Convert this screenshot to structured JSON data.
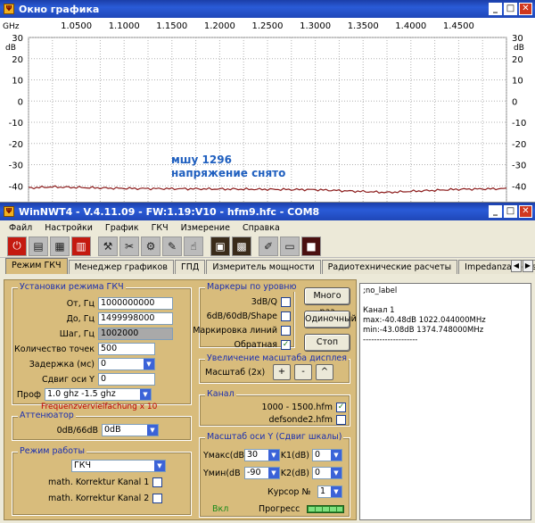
{
  "graph_window": {
    "title": "Окно графика",
    "unit_x": "GHz",
    "x_ticks": [
      "1.0500",
      "1.1000",
      "1.1500",
      "1.2000",
      "1.2500",
      "1.3000",
      "1.3500",
      "1.4000",
      "1.4500"
    ],
    "y_ticks_left": [
      "30",
      "dB",
      "20",
      "10",
      "0",
      "-10",
      "-20",
      "-30",
      "-40"
    ],
    "y_ticks_right": [
      "30",
      "dB",
      "20",
      "10",
      "0",
      "-10",
      "-20",
      "-30",
      "-40"
    ],
    "annotation_line1": "мшу 1296",
    "annotation_line2": "напряжение снято",
    "colors": {
      "trace": "#8b1a1a",
      "annotation": "#1f5fbf",
      "grid": "#b0b0b0"
    }
  },
  "chart_data": {
    "type": "line",
    "xlabel": "GHz",
    "ylabel": "dB",
    "xlim": [
      1.0,
      1.5
    ],
    "ylim": [
      -40,
      30
    ],
    "grid": true,
    "series": [
      {
        "name": "Канал 1",
        "x": [
          1.0,
          1.022,
          1.1,
          1.2,
          1.3,
          1.375,
          1.45,
          1.5
        ],
        "y": [
          -41.0,
          -40.5,
          -41.2,
          -41.5,
          -41.8,
          -43.1,
          -41.6,
          -41.3
        ]
      }
    ]
  },
  "main_window": {
    "title": "WinNWT4 - V.4.11.09 - FW:1.19:V10 - hfm9.hfc - COM8",
    "menu": [
      "Файл",
      "Настройки",
      "График",
      "ГКЧ",
      "Измерение",
      "Справка"
    ],
    "tabs": [
      "Режим ГКЧ",
      "Менеджер графиков",
      "ГПД",
      "Измеритель мощности",
      "Радиотехнические расчеты",
      "Impedanzanpass"
    ],
    "sweep_group": {
      "title": "Установки режима ГКЧ",
      "from_label": "От, Гц",
      "from_value": "1000000000",
      "to_label": "До, Гц",
      "to_value": "1499998000",
      "step_label": "Шаг, Гц",
      "step_value": "1002000",
      "points_label": "Количество точек",
      "points_value": "500",
      "delay_label": "Задержка (мс)",
      "delay_value": "0",
      "yshift_label": "Сдвиг оси Y",
      "yshift_value": "0",
      "profile_label": "Проф",
      "profile_value": "1.0 ghz -1.5 ghz",
      "freq_mult": "Frequenzvervielfachung x 10"
    },
    "attenuator_group": {
      "title": "Аттенюатор",
      "label": "0dB/66dB",
      "value": "0dB"
    },
    "mode_group": {
      "title": "Режим работы",
      "value": "ГКЧ",
      "math1": "math. Korrektur Kanal 1",
      "math2": "math. Korrektur Kanal 2"
    },
    "markers_group": {
      "title": "Маркеры по уровню",
      "m1": "3dB/Q",
      "m2": "6dB/60dB/Shape",
      "m3": "Маркировка линий",
      "m4": "Обратная"
    },
    "zoom_group": {
      "title": "Увеличение масштаба дисплея",
      "label": "Масштаб (2x)",
      "plus": "+",
      "minus": "-",
      "reset": "^"
    },
    "channel_group": {
      "title": "Канал",
      "c1": "1000 - 1500.hfm",
      "c2": "defsonde2.hfm"
    },
    "yscale_group": {
      "title": "Масштаб оси Y (Сдвиг шкалы)",
      "ymax_label": "Yмакс(dB",
      "ymax_value": "30",
      "ymin_label": "Yмин(dB",
      "ymin_value": "-90",
      "k1_label": "K1(dB)",
      "k1_value": "0",
      "k2_label": "K2(dB)",
      "k2_value": "0",
      "cursor_label": "Курсор №",
      "cursor_value": "1",
      "on_label": "Вкл",
      "progress_label": "Прогресс"
    },
    "buttons": {
      "repeat": "Много раз",
      "single": "Одиночный",
      "stop": "Стоп"
    },
    "output": {
      "line1": ";no_label",
      "line2": "Канал 1",
      "line3": "max:-40.48dB 1022.044000MHz",
      "line4": "min:-43.08dB 1374.748000MHz",
      "line5": "--------------------"
    }
  }
}
